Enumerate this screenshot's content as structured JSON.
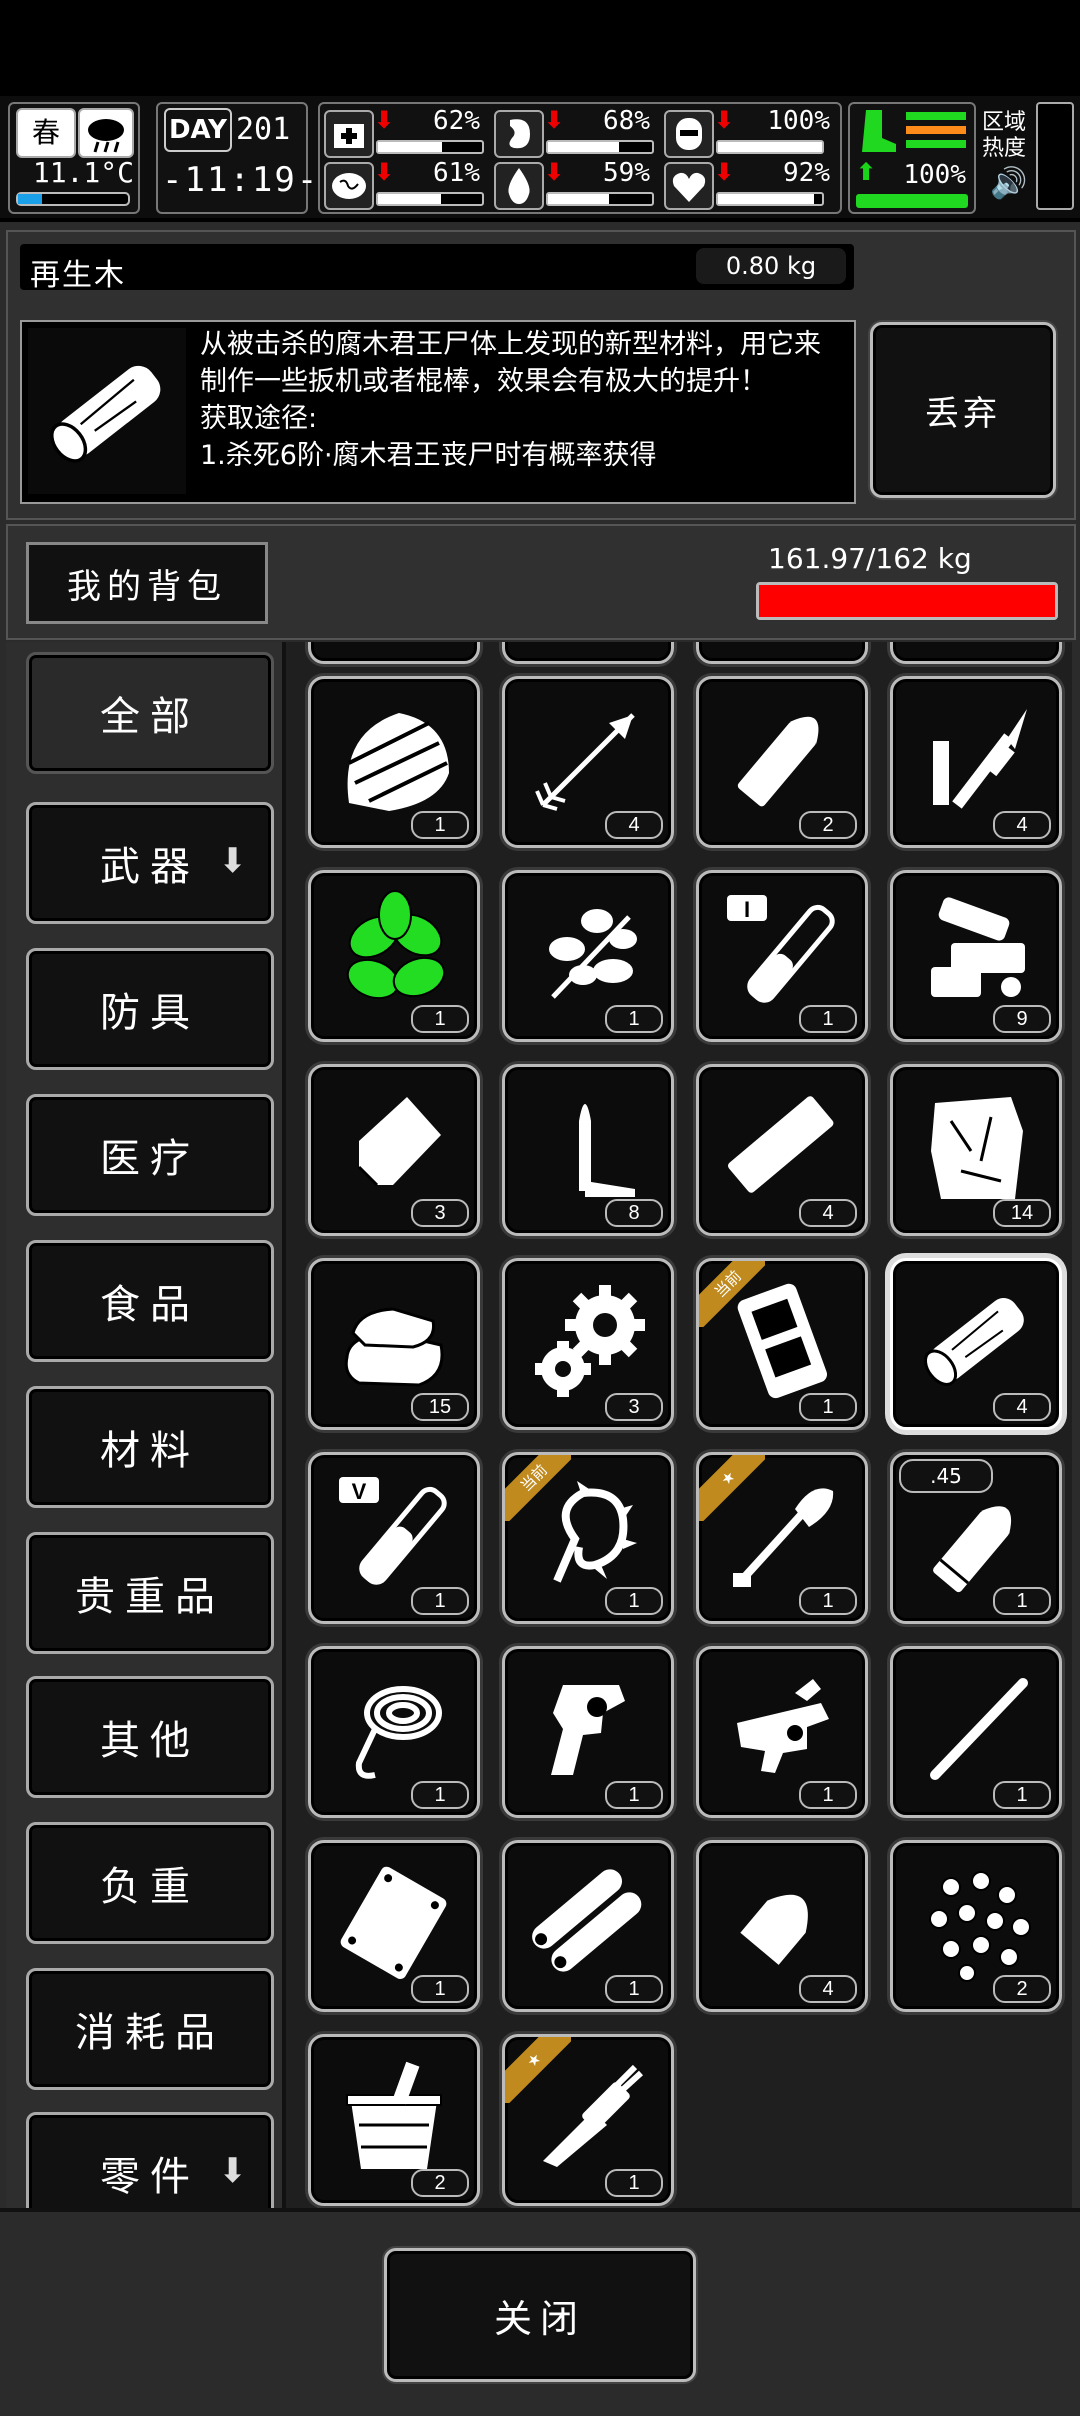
{
  "hud": {
    "season": "春",
    "temperature": "11.1°C",
    "day_label": "DAY",
    "day_number": "201",
    "clock": "-11:19-",
    "stats": [
      {
        "name": "health",
        "pct": "62%",
        "value": 0.62,
        "icon": "first-aid-icon"
      },
      {
        "name": "hunger",
        "pct": "68%",
        "value": 0.68,
        "icon": "stomach-icon"
      },
      {
        "name": "armor",
        "pct": "100%",
        "value": 1.0,
        "icon": "armor-icon"
      },
      {
        "name": "mental",
        "pct": "61%",
        "value": 0.61,
        "icon": "brain-icon"
      },
      {
        "name": "thirst",
        "pct": "59%",
        "value": 0.59,
        "icon": "water-drop-icon"
      },
      {
        "name": "heart",
        "pct": "92%",
        "value": 0.92,
        "icon": "heart-icon"
      }
    ],
    "stamina_pct": "100%",
    "zone_heat": "区域热度"
  },
  "item": {
    "name": "再生木",
    "weight": "0.80 kg",
    "description": "从被击杀的腐木君王尸体上发现的新型材料，用它来制作一些扳机或者棍棒，效果会有极大的提升！",
    "source_label": "获取途径:",
    "source_1": "1.杀死6阶·腐木君王丧尸时有概率获得",
    "discard": "丢弃"
  },
  "bag": {
    "title": "我的背包",
    "capacity": "161.97/162 kg",
    "fill": 0.9998,
    "fill_color": "#ff0000"
  },
  "categories": [
    "全部",
    "武器",
    "防具",
    "医疗",
    "食品",
    "材料",
    "贵重品",
    "其他",
    "负重",
    "消耗品",
    "零件"
  ],
  "items": [
    {
      "icon": "wood-planks-icon",
      "count": "1"
    },
    {
      "icon": "arrow-icon",
      "count": "4"
    },
    {
      "icon": "bullet-tip-icon",
      "count": "2"
    },
    {
      "icon": "spear-parts-icon",
      "count": "4"
    },
    {
      "icon": "herb-leaf-icon",
      "count": "1",
      "color": "#22cc22"
    },
    {
      "icon": "flower-branch-icon",
      "count": "1"
    },
    {
      "icon": "test-tube-i-icon",
      "count": "1",
      "tube": "I"
    },
    {
      "icon": "gun-parts-icon",
      "count": "9"
    },
    {
      "icon": "metal-plate-icon",
      "count": "3"
    },
    {
      "icon": "bullet-casing-icon",
      "count": "8"
    },
    {
      "icon": "metal-bar-icon",
      "count": "4"
    },
    {
      "icon": "torn-cloth-icon",
      "count": "14"
    },
    {
      "icon": "folded-cloth-icon",
      "count": "15"
    },
    {
      "icon": "gears-icon",
      "count": "3"
    },
    {
      "icon": "vest-icon",
      "count": "1",
      "badge": "当前"
    },
    {
      "icon": "regen-wood-icon",
      "count": "4",
      "selected": true
    },
    {
      "icon": "test-tube-v-icon",
      "count": "1",
      "tube": "V"
    },
    {
      "icon": "spiked-whip-icon",
      "count": "1",
      "badge": "当前"
    },
    {
      "icon": "shovel-icon",
      "count": "1",
      "badge": "★"
    },
    {
      "icon": "bullet-45-icon",
      "count": "1",
      "caliber": ".45"
    },
    {
      "icon": "rope-hook-icon",
      "count": "1"
    },
    {
      "icon": "revolver-icon",
      "count": "1"
    },
    {
      "icon": "trigger-mechanism-icon",
      "count": "1"
    },
    {
      "icon": "metal-rod-icon",
      "count": "1"
    },
    {
      "icon": "sheet-metal-icon",
      "count": "1"
    },
    {
      "icon": "pipes-icon",
      "count": "1"
    },
    {
      "icon": "bullet-head-icon",
      "count": "4"
    },
    {
      "icon": "pellets-icon",
      "count": "2"
    },
    {
      "icon": "bucket-icon",
      "count": "2"
    },
    {
      "icon": "hunting-knife-icon",
      "count": "1",
      "badge": "★"
    }
  ],
  "close": "关闭"
}
